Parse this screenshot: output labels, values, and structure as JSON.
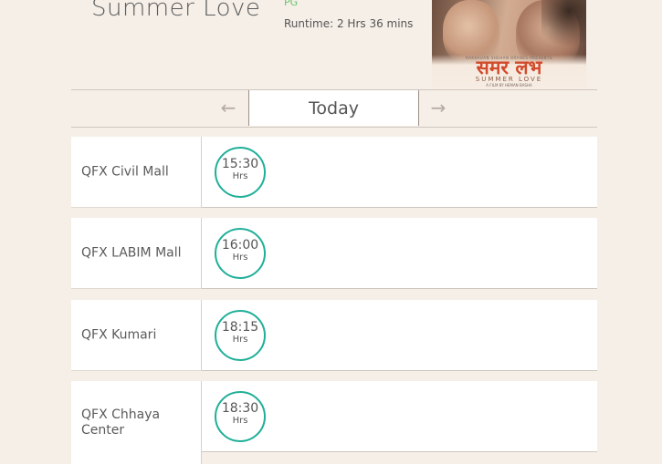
{
  "movie": {
    "title": "Summer Love",
    "rating": "PG",
    "runtime": "Runtime: 2 Hrs 36 mins",
    "poster": {
      "tagline": "RAKKAUAN SHEHAN BRANES PRESENTS",
      "devanagari_title": "समर लभ",
      "latin_title": "SUMMER LOVE",
      "credit": "A FILM BY HEMAN BASHA"
    }
  },
  "day_nav": {
    "prev_icon": "←",
    "label": "Today",
    "next_icon": "→"
  },
  "showtimes": [
    {
      "theater": "QFX Civil Mall",
      "time": "15:30",
      "unit": "Hrs"
    },
    {
      "theater": "QFX LABIM Mall",
      "time": "16:00",
      "unit": "Hrs"
    },
    {
      "theater": "QFX Kumari",
      "time": "18:15",
      "unit": "Hrs"
    },
    {
      "theater": "QFX Chhaya Center",
      "time": "18:30",
      "unit": "Hrs"
    }
  ],
  "colors": {
    "background": "#f5efe8",
    "slot_ring": "#1faf98",
    "rating": "#6cc36c"
  }
}
